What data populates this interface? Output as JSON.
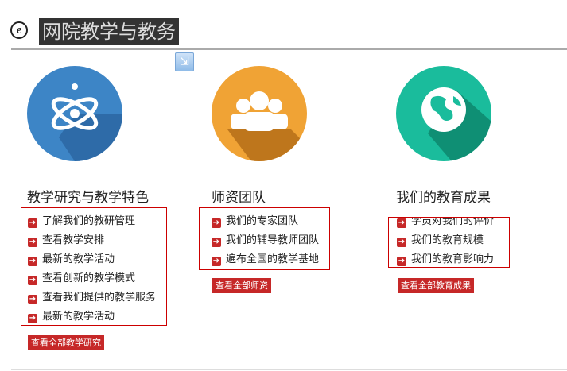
{
  "header": {
    "title": "网院教学与教务",
    "icon": "ie-e-icon"
  },
  "colors": {
    "blue": "#3d85c6",
    "orange": "#f0a335",
    "green": "#1abc9c",
    "accent": "#c62828"
  },
  "columns": [
    {
      "title": "教学研究与教学特色",
      "icon": "atom-icon",
      "items": [
        "了解我们的教研管理",
        "查看教学安排",
        "最新的教学活动",
        "查看创新的教学模式",
        "查看我们提供的教学服务",
        "最新的教学活动"
      ],
      "button": "查看全部教学研究"
    },
    {
      "title": "师资团队",
      "icon": "users-icon",
      "items": [
        "我们的专家团队",
        "我们的辅导教师团队",
        "遍布全国的教学基地"
      ],
      "button": "查看全部师资"
    },
    {
      "title": "我们的教育成果",
      "icon": "globe-icon",
      "items": [
        "学员对我们的评价",
        "我们的教育规模",
        "我们的教育影响力"
      ],
      "button": "查看全部教育成果"
    }
  ]
}
